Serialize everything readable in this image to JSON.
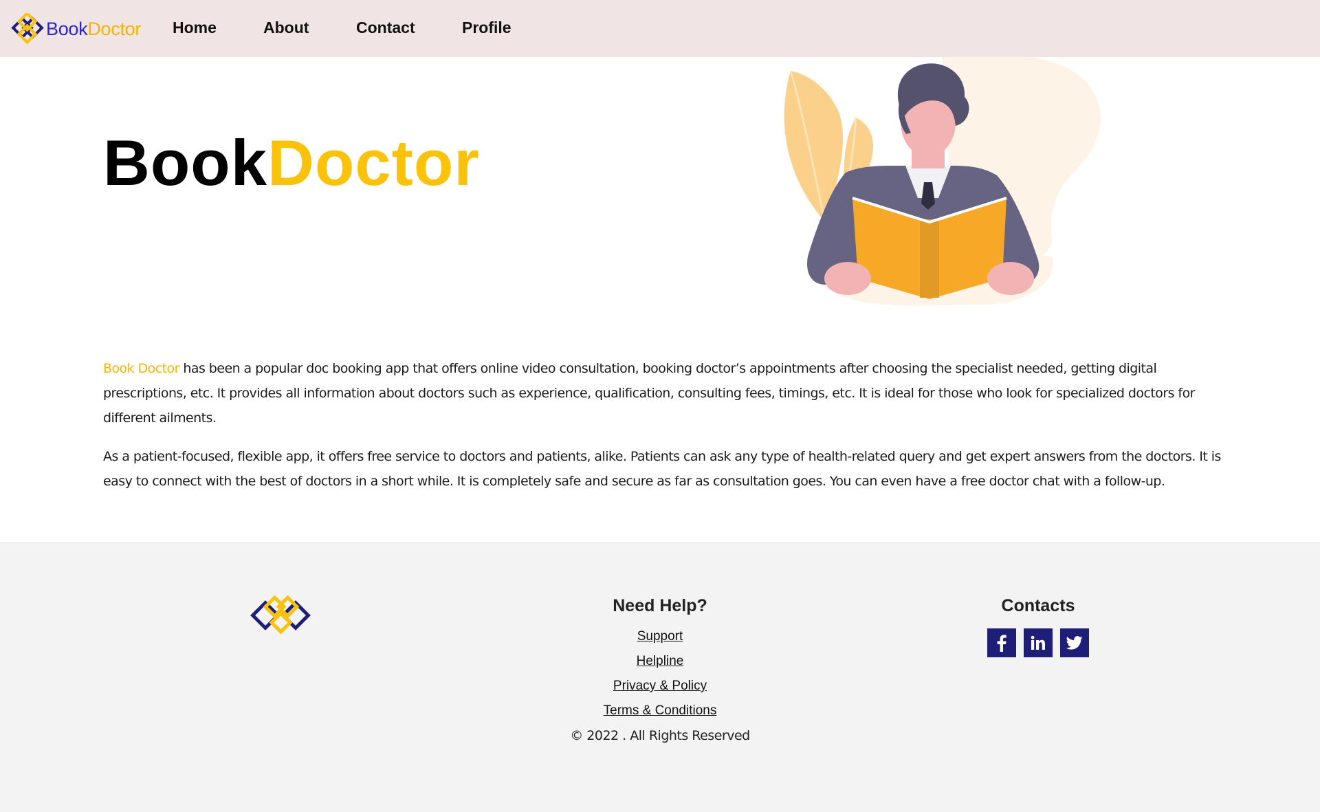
{
  "brand": {
    "name_part1": "Book",
    "name_part2": "Doctor",
    "color_primary": "#2a27c8",
    "color_accent": "#f4b400"
  },
  "nav": {
    "items": [
      {
        "label": "Home"
      },
      {
        "label": "About"
      },
      {
        "label": "Contact"
      },
      {
        "label": "Profile"
      }
    ]
  },
  "hero": {
    "title_part1": "Book",
    "title_part2": "Doctor",
    "illustration": "man-reading-book-illustration"
  },
  "about": {
    "highlight": "Book Doctor",
    "paragraph1_rest": " has been a popular doc booking app that offers online video consultation, booking doctor’s appointments after choosing the specialist needed, getting digital prescriptions, etc. It provides all information about doctors such as experience, qualification, consulting fees, timings, etc. It is ideal for those who look for specialized doctors for different ailments.",
    "paragraph2": "As a patient-focused, flexible app, it offers free service to doctors and patients, alike. Patients can ask any type of health-related query and get expert answers from the doctors. It is easy to connect with the best of doctors in a short while. It is completely safe and secure as far as consultation goes. You can even have a free doctor chat with a follow-up."
  },
  "footer": {
    "help": {
      "title": "Need Help?",
      "links": [
        {
          "label": "Support"
        },
        {
          "label": "Helpline"
        },
        {
          "label": "Privacy & Policy"
        },
        {
          "label": "Terms & Conditions"
        }
      ]
    },
    "copyright": "© 2022 . All Rights Reserved",
    "contacts": {
      "title": "Contacts",
      "social": [
        {
          "icon": "facebook-icon",
          "label": "f"
        },
        {
          "icon": "linkedin-icon",
          "label": "in"
        },
        {
          "icon": "twitter-icon"
        }
      ],
      "social_bg": "#1e1e78"
    }
  }
}
